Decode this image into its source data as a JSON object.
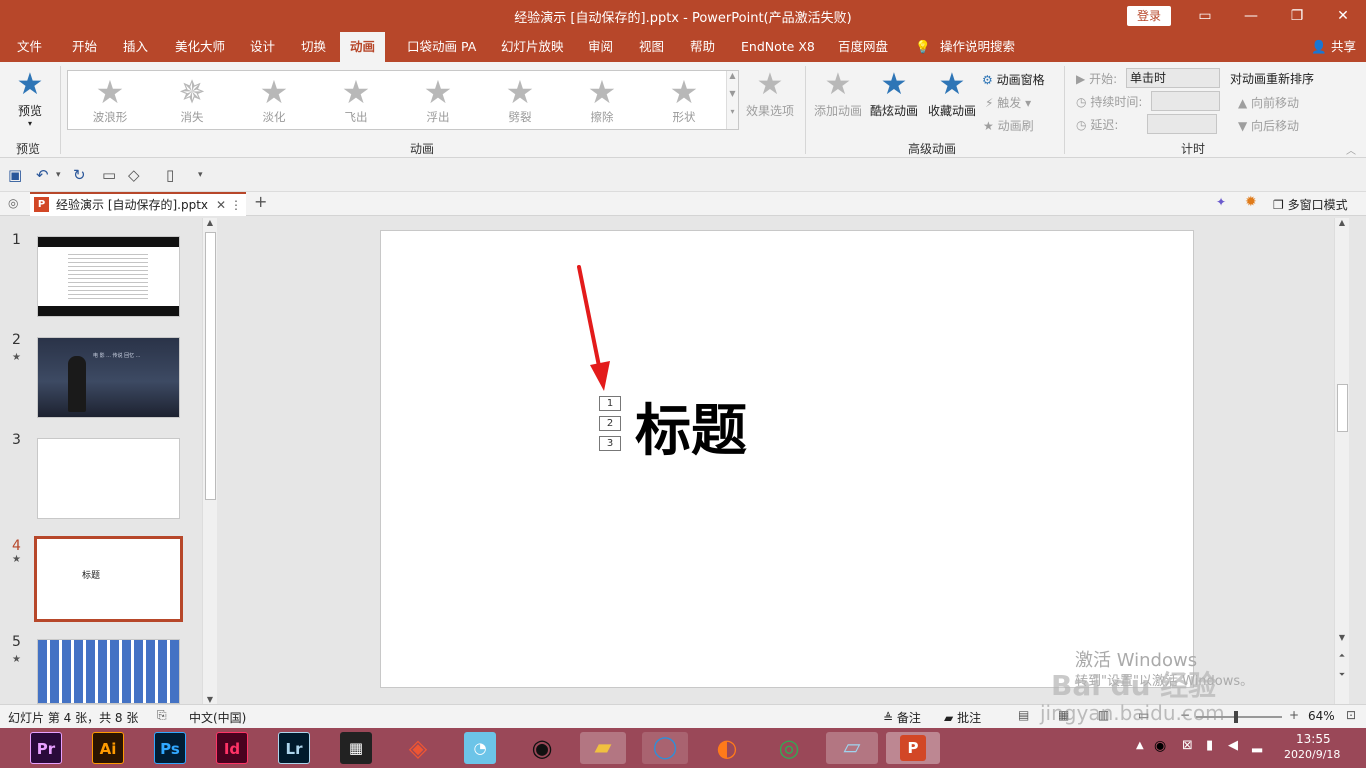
{
  "window": {
    "title": "经验演示 [自动保存的].pptx  -  PowerPoint(产品激活失败)",
    "login_label": "登录"
  },
  "ribbon_tabs": [
    "文件",
    "开始",
    "插入",
    "美化大师",
    "设计",
    "切换",
    "动画",
    "口袋动画 PA",
    "幻灯片放映",
    "审阅",
    "视图",
    "帮助",
    "EndNote X8",
    "百度网盘",
    "操作说明搜索"
  ],
  "active_tab": "动画",
  "share_label": "共享",
  "preview": {
    "label": "预览",
    "group": "预览"
  },
  "animations": {
    "group": "动画",
    "items": [
      "波浪形",
      "消失",
      "淡化",
      "飞出",
      "浮出",
      "劈裂",
      "擦除",
      "形状"
    ],
    "effect_options": "效果选项"
  },
  "advanced": {
    "group": "高级动画",
    "add_animation": "添加动画",
    "cool_animation": "酷炫动画",
    "fav_animation": "收藏动画",
    "pane": "动画窗格",
    "trigger": "触发",
    "painter": "动画刷"
  },
  "timing": {
    "group": "计时",
    "start_label": "开始:",
    "start_value": "单击时",
    "duration_label": "持续时间:",
    "delay_label": "延迟:",
    "reorder": "对动画重新排序",
    "forward": "向前移动",
    "backward": "向后移动"
  },
  "doc_tab": "经验演示  [自动保存的].pptx",
  "multiwindow": "多窗口模式",
  "slides": [
    {
      "num": "1",
      "star": ""
    },
    {
      "num": "2",
      "star": "★"
    },
    {
      "num": "3",
      "star": ""
    },
    {
      "num": "4",
      "star": "★",
      "text": "标题"
    },
    {
      "num": "5",
      "star": "★"
    }
  ],
  "thumb2_text": "电 影 ...  传说 回忆 ...",
  "slide": {
    "title": "标题",
    "tags": [
      "1",
      "2",
      "3"
    ]
  },
  "status": {
    "slide_info": "幻灯片 第 4 张，共 8 张",
    "language": "中文(中国)",
    "notes": "备注",
    "comments": "批注",
    "zoom": "64%"
  },
  "activation": {
    "line1": "激活 Windows",
    "line2": "转到\"设置\"以激活 Windows。"
  },
  "watermark": {
    "brand": "Bai du 经验",
    "url": "jingyan.baidu.com"
  },
  "taskbar": {
    "apps": [
      "Pr",
      "Ai",
      "Ps",
      "Id",
      "Lr"
    ],
    "time": "13:55",
    "date": "2020/9/18"
  },
  "colors": {
    "accent": "#b7472a",
    "taskbar": "#9a4858",
    "arrow": "#e31b1b",
    "star_blue": "#2e75b6"
  }
}
